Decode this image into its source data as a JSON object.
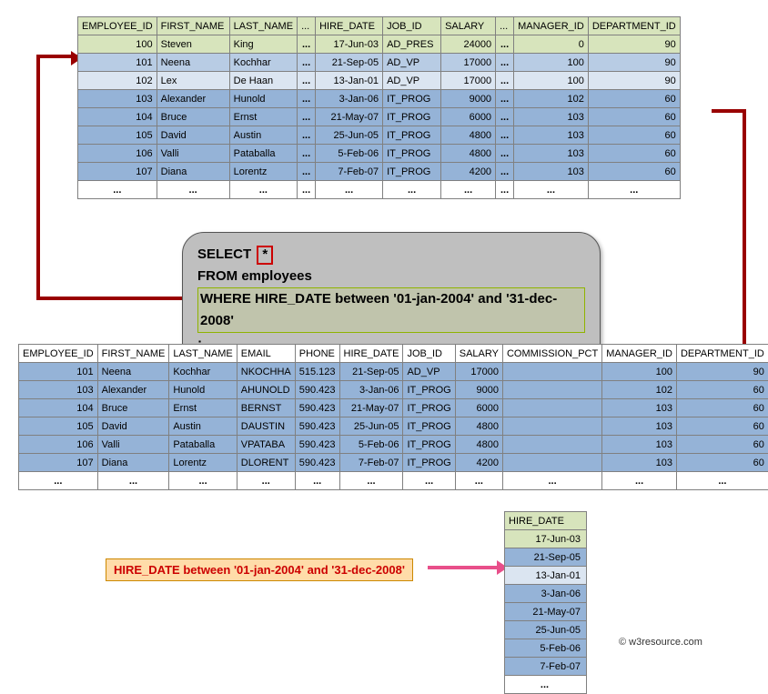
{
  "table1": {
    "headers": [
      "EMPLOYEE_ID",
      "FIRST_NAME",
      "LAST_NAME",
      "...",
      "HIRE_DATE",
      "JOB_ID",
      "SALARY",
      "...",
      "MANAGER_ID",
      "DEPARTMENT_ID"
    ],
    "rows": [
      {
        "emp": "100",
        "fn": "Steven",
        "ln": "King",
        "hd": "17-Jun-03",
        "job": "AD_PRES",
        "sal": "24000",
        "mgr": "0",
        "dep": "90"
      },
      {
        "emp": "101",
        "fn": "Neena",
        "ln": "Kochhar",
        "hd": "21-Sep-05",
        "job": "AD_VP",
        "sal": "17000",
        "mgr": "100",
        "dep": "90"
      },
      {
        "emp": "102",
        "fn": "Lex",
        "ln": "De Haan",
        "hd": "13-Jan-01",
        "job": "AD_VP",
        "sal": "17000",
        "mgr": "100",
        "dep": "90"
      },
      {
        "emp": "103",
        "fn": "Alexander",
        "ln": "Hunold",
        "hd": "3-Jan-06",
        "job": "IT_PROG",
        "sal": "9000",
        "mgr": "102",
        "dep": "60"
      },
      {
        "emp": "104",
        "fn": "Bruce",
        "ln": "Ernst",
        "hd": "21-May-07",
        "job": "IT_PROG",
        "sal": "6000",
        "mgr": "103",
        "dep": "60"
      },
      {
        "emp": "105",
        "fn": "David",
        "ln": "Austin",
        "hd": "25-Jun-05",
        "job": "IT_PROG",
        "sal": "4800",
        "mgr": "103",
        "dep": "60"
      },
      {
        "emp": "106",
        "fn": "Valli",
        "ln": "Pataballa",
        "hd": "5-Feb-06",
        "job": "IT_PROG",
        "sal": "4800",
        "mgr": "103",
        "dep": "60"
      },
      {
        "emp": "107",
        "fn": "Diana",
        "ln": "Lorentz",
        "hd": "7-Feb-07",
        "job": "IT_PROG",
        "sal": "4200",
        "mgr": "103",
        "dep": "60"
      }
    ]
  },
  "sql": {
    "select": "SELECT",
    "star": "*",
    "from": "FROM employees",
    "where": "WHERE HIRE_DATE between '01-jan-2004' and '31-dec-2008'",
    "semicolon": ";"
  },
  "table2": {
    "headers": [
      "EMPLOYEE_ID",
      "FIRST_NAME",
      "LAST_NAME",
      "EMAIL",
      "PHONE",
      "HIRE_DATE",
      "JOB_ID",
      "SALARY",
      "COMMISSION_PCT",
      "MANAGER_ID",
      "DEPARTMENT_ID"
    ],
    "rows": [
      {
        "emp": "101",
        "fn": "Neena",
        "ln": "Kochhar",
        "email": "NKOCHHA",
        "ph": "515.123",
        "hd": "21-Sep-05",
        "job": "AD_VP",
        "sal": "17000",
        "cp": "",
        "mgr": "100",
        "dep": "90"
      },
      {
        "emp": "103",
        "fn": "Alexander",
        "ln": "Hunold",
        "email": "AHUNOLD",
        "ph": "590.423",
        "hd": "3-Jan-06",
        "job": "IT_PROG",
        "sal": "9000",
        "cp": "",
        "mgr": "102",
        "dep": "60"
      },
      {
        "emp": "104",
        "fn": "Bruce",
        "ln": "Ernst",
        "email": "BERNST",
        "ph": "590.423",
        "hd": "21-May-07",
        "job": "IT_PROG",
        "sal": "6000",
        "cp": "",
        "mgr": "103",
        "dep": "60"
      },
      {
        "emp": "105",
        "fn": "David",
        "ln": "Austin",
        "email": "DAUSTIN",
        "ph": "590.423",
        "hd": "25-Jun-05",
        "job": "IT_PROG",
        "sal": "4800",
        "cp": "",
        "mgr": "103",
        "dep": "60"
      },
      {
        "emp": "106",
        "fn": "Valli",
        "ln": "Pataballa",
        "email": "VPATABA",
        "ph": "590.423",
        "hd": "5-Feb-06",
        "job": "IT_PROG",
        "sal": "4800",
        "cp": "",
        "mgr": "103",
        "dep": "60"
      },
      {
        "emp": "107",
        "fn": "Diana",
        "ln": "Lorentz",
        "email": "DLORENT",
        "ph": "590.423",
        "hd": "7-Feb-07",
        "job": "IT_PROG",
        "sal": "4200",
        "cp": "",
        "mgr": "103",
        "dep": "60"
      }
    ]
  },
  "condition_text": "HIRE_DATE between '01-jan-2004' and '31-dec-2008'",
  "table3": {
    "header": "HIRE_DATE",
    "rows": [
      "17-Jun-03",
      "21-Sep-05",
      "13-Jan-01",
      "3-Jan-06",
      "21-May-07",
      "25-Jun-05",
      "5-Feb-06",
      "7-Feb-07"
    ]
  },
  "copyright": "© w3resource.com",
  "colwidths": {
    "t1": [
      80,
      80,
      74,
      20,
      74,
      64,
      60,
      20,
      80,
      94
    ],
    "t2": [
      74,
      70,
      68,
      56,
      48,
      64,
      56,
      54,
      100,
      76,
      90
    ],
    "t3": [
      90
    ]
  }
}
